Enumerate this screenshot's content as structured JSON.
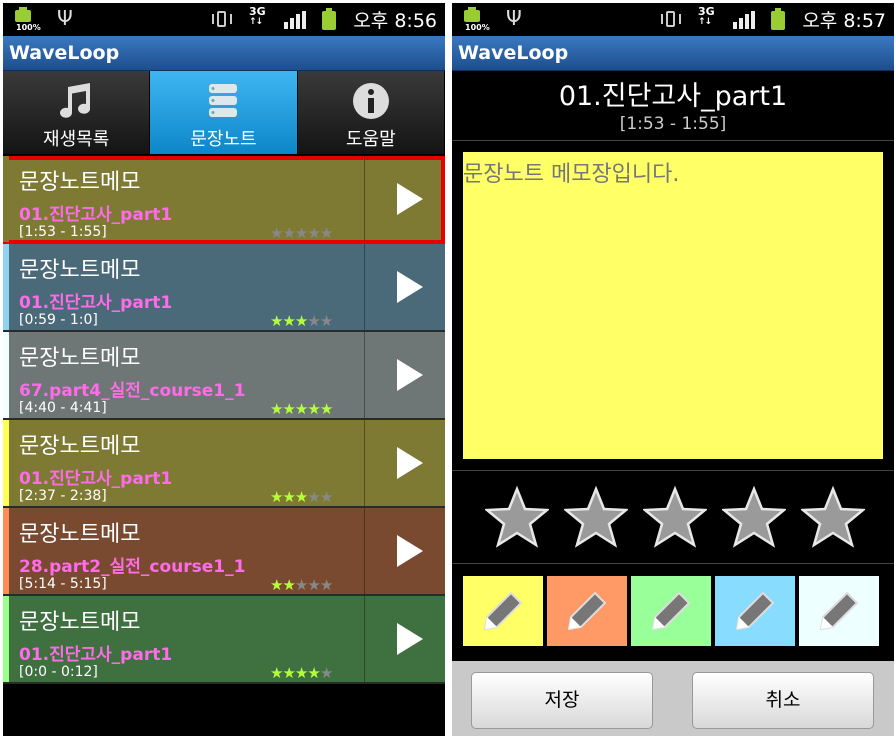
{
  "status": {
    "battery_percent_label": "100%",
    "left_time": "오후 8:56",
    "right_time": "오후 8:57",
    "network": "3G"
  },
  "app_title": "WaveLoop",
  "tabs": [
    {
      "label": "재생목록",
      "icon": "music-note-icon"
    },
    {
      "label": "문장노트",
      "icon": "sentence-note-icon"
    },
    {
      "label": "도움말",
      "icon": "info-icon"
    }
  ],
  "notes": [
    {
      "memo": "문장노트메모",
      "song": "01.진단고사_part1",
      "range": "[1:53 - 1:55]",
      "rating": 0,
      "color": "#7f7a33",
      "strip": "#7f7a33"
    },
    {
      "memo": "문장노트메모",
      "song": "01.진단고사_part1",
      "range": "[0:59 - 1:0]",
      "rating": 3,
      "color": "#4a6a7a",
      "strip": "#8fd3f0"
    },
    {
      "memo": "문장노트메모",
      "song": "67.part4_실전_course1_1",
      "range": "[4:40 - 4:41]",
      "rating": 5,
      "color": "#6e7676",
      "strip": "#f2ffff"
    },
    {
      "memo": "문장노트메모",
      "song": "01.진단고사_part1",
      "range": "[2:37 - 2:38]",
      "rating": 3,
      "color": "#7f7a33",
      "strip": "#ffff55"
    },
    {
      "memo": "문장노트메모",
      "song": "28.part2_실전_course1_1",
      "range": "[5:14 - 5:15]",
      "rating": 1.5,
      "color": "#7a4a30",
      "strip": "#ff8c55"
    },
    {
      "memo": "문장노트메모",
      "song": "01.진단고사_part1",
      "range": "[0:0 - 0:12]",
      "rating": 4,
      "color": "#3f7040",
      "strip": "#99ff88"
    }
  ],
  "editor": {
    "song_title": "01.진단고사_part1",
    "song_range": "[1:53 - 1:55]",
    "memo_text": "문장노트 메모장입니다.",
    "rating_max": 5,
    "colors": [
      "#ffff66",
      "#ff9966",
      "#99ff99",
      "#88ddff",
      "#eeffff"
    ],
    "save_label": "저장",
    "cancel_label": "취소"
  }
}
